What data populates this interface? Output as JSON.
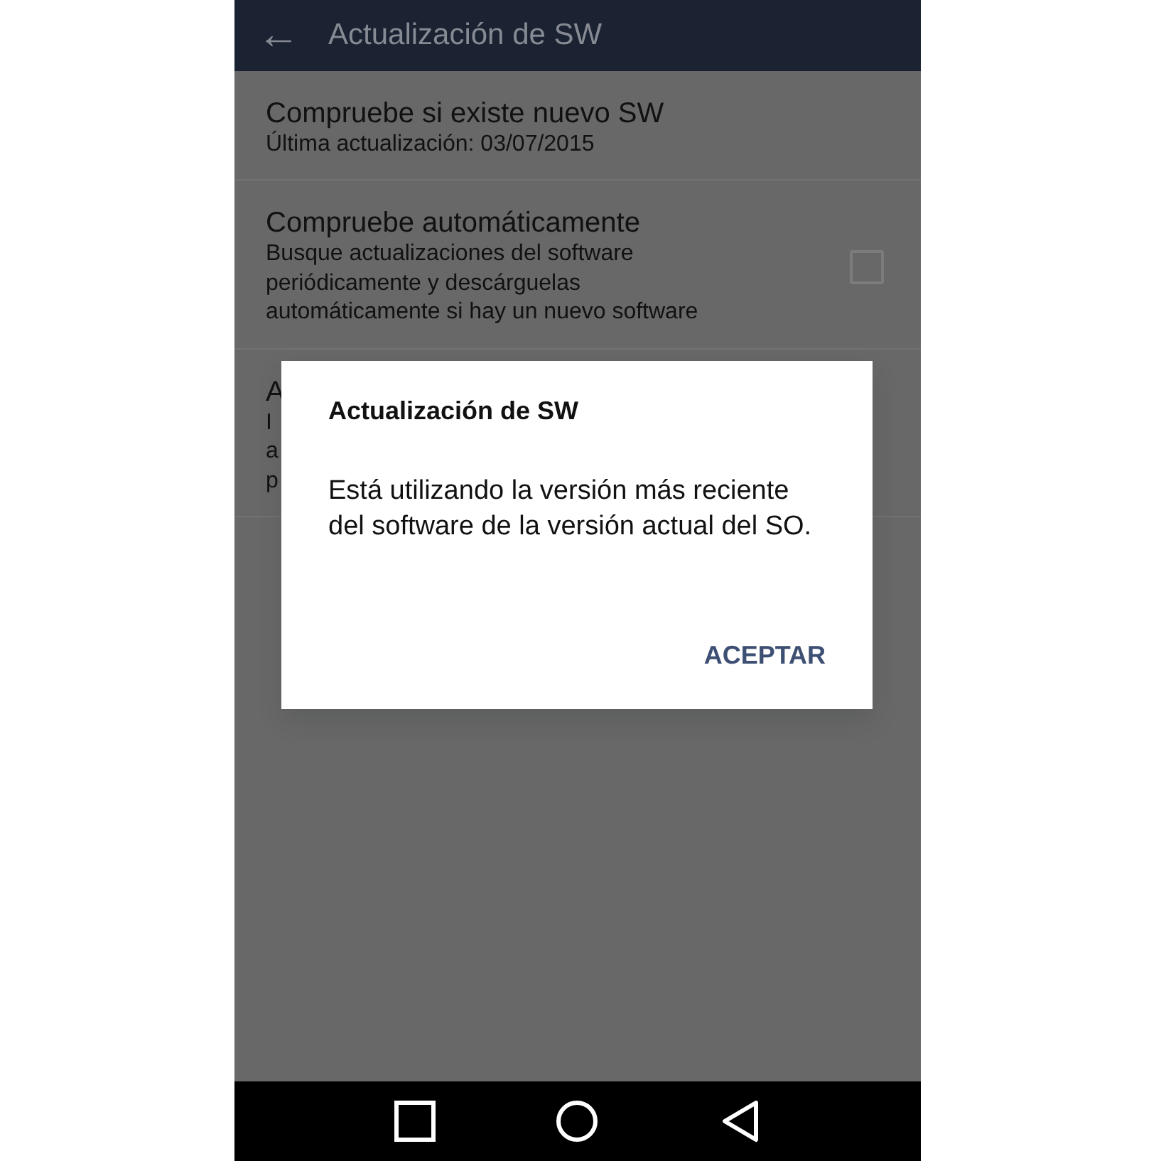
{
  "app_bar": {
    "back_icon": "←",
    "title": "Actualización de SW"
  },
  "settings": [
    {
      "kind": "plain",
      "title": "Compruebe si existe nuevo SW",
      "description": [
        "Última actualización: 03/07/2015"
      ]
    },
    {
      "kind": "checkbox",
      "title": "Compruebe automáticamente",
      "description": [
        "Busque actualizaciones del software",
        "periódicamente y descárguelas",
        "automáticamente si hay un nuevo software"
      ],
      "checked": false
    },
    {
      "kind": "plain",
      "title": "A",
      "description": [
        "I",
        "a",
        "p"
      ]
    }
  ],
  "dialog": {
    "title": "Actualización de SW",
    "message": "Está utilizando la versión más reciente del software de la versión actual del SO.",
    "buttons": [
      "ACEPTAR"
    ]
  },
  "nav_bar": [
    {
      "kind": "recents"
    },
    {
      "kind": "home"
    },
    {
      "kind": "back"
    }
  ]
}
